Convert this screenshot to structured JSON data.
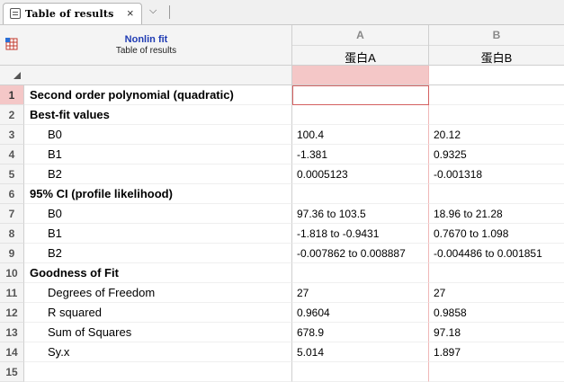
{
  "tab": {
    "title": "Table of results",
    "close_glyph": "×",
    "dropdown_glyph": "⌵"
  },
  "header": {
    "title": "Nonlin fit",
    "subtitle": "Table of results"
  },
  "columns": [
    {
      "letter": "A",
      "name": "蛋白A"
    },
    {
      "letter": "B",
      "name": "蛋白B"
    }
  ],
  "rows": [
    {
      "num": "1",
      "label": "Second order polynomial (quadratic)",
      "style": "bold",
      "a": "",
      "b": ""
    },
    {
      "num": "2",
      "label": "Best-fit values",
      "style": "bold",
      "a": "",
      "b": ""
    },
    {
      "num": "3",
      "label": "B0",
      "style": "indent",
      "a": "100.4",
      "b": "20.12"
    },
    {
      "num": "4",
      "label": "B1",
      "style": "indent",
      "a": "-1.381",
      "b": "0.9325"
    },
    {
      "num": "5",
      "label": "B2",
      "style": "indent",
      "a": "0.0005123",
      "b": "-0.001318"
    },
    {
      "num": "6",
      "label": "95% CI (profile likelihood)",
      "style": "bold",
      "a": "",
      "b": ""
    },
    {
      "num": "7",
      "label": "B0",
      "style": "indent",
      "a": "97.36 to 103.5",
      "b": "18.96 to 21.28"
    },
    {
      "num": "8",
      "label": "B1",
      "style": "indent",
      "a": "-1.818 to -0.9431",
      "b": "0.7670 to 1.098"
    },
    {
      "num": "9",
      "label": "B2",
      "style": "indent",
      "a": "-0.007862 to 0.008887",
      "b": "-0.004486 to 0.001851"
    },
    {
      "num": "10",
      "label": "Goodness of Fit",
      "style": "bold",
      "a": "",
      "b": ""
    },
    {
      "num": "11",
      "label": "Degrees of Freedom",
      "style": "indent",
      "a": "27",
      "b": "27"
    },
    {
      "num": "12",
      "label": "R squared",
      "style": "indent",
      "a": "0.9604",
      "b": "0.9858"
    },
    {
      "num": "13",
      "label": "Sum of Squares",
      "style": "indent",
      "a": "678.9",
      "b": "97.18"
    },
    {
      "num": "14",
      "label": "Sy.x",
      "style": "indent",
      "a": "5.014",
      "b": "1.897"
    },
    {
      "num": "15",
      "label": "",
      "style": "indent",
      "a": "",
      "b": ""
    }
  ],
  "selection": {
    "row": "1",
    "column": "A",
    "color": "#f4c7c7",
    "border": "#d46060"
  }
}
